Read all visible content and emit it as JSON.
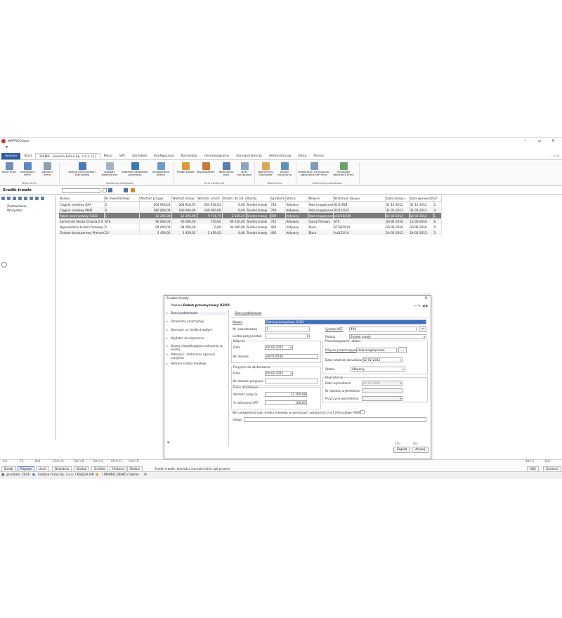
{
  "window": {
    "title": "WAPRO Kaper"
  },
  "tabs": [
    "System",
    "Start",
    "FIRMA : Solidna Firma Sp. z o.o. [1]",
    "Płace",
    "VAT",
    "Kartoteki",
    "Konfiguracja",
    "Narzędzia",
    "Harmonogramy",
    "Korespondencja",
    "Administracja",
    "Okna",
    "Pomoc"
  ],
  "ribbon": {
    "buttons": [
      {
        "label": "Dane firmy"
      },
      {
        "label": "Udziałowcy firmy"
      },
      {
        "label": "Zamknij firmę"
      },
      {
        "label": "Księga przychodów i rozchodów"
      },
      {
        "label": "Dowody wewnętrzne"
      },
      {
        "label": "Składniki zestawień sprzedaży"
      },
      {
        "label": "Księgowanie detalu"
      },
      {
        "label": "Środki trwałe"
      },
      {
        "label": "Wyposażenie"
      },
      {
        "label": "Rozliczenie jazd"
      },
      {
        "label": "Noty korygujące"
      },
      {
        "label": "Dokumenty finansowe"
      },
      {
        "label": "Zapisy rozliczenia"
      },
      {
        "label": "Deklaracje, Formularze, zgłoszenia NIP firmy"
      },
      {
        "label": "Szczegóły deklaracji firmy"
      }
    ],
    "groups": [
      "Dane firmy",
      "Ewidencja księgowa",
      "Inne ewidencje",
      "Rozliczenia",
      "Deklaracje podatkowe"
    ]
  },
  "section": {
    "title": "Środki trwałe"
  },
  "tree": [
    "Zaznaczone",
    "Wszystko"
  ],
  "grid": {
    "columns": [
      "Nazwa",
      "Nr inwentarzowy",
      "Wartość przyjęc",
      "Wartość bieżąc",
      "Wartość umorz",
      "Pozost. do zał. o",
      "Rodzaj",
      "Symbol K",
      "Status",
      "Miejsce",
      "Nr/data/w zakupu",
      "Data zakupu",
      "Data wprowadź",
      "LP"
    ],
    "rows": [
      [
        "Ciągnik siodłowy DAF",
        "2",
        "204 918,03",
        "204 918,03",
        "204 918,03",
        "0,00",
        "Środek trwały",
        "746",
        "Aktywny",
        "Hala magazynowa",
        "01/1/958",
        "31-12-2012",
        "31-12-2012",
        "2"
      ],
      [
        "Ciągnik siodłowy MAN",
        "4",
        "180 000,00",
        "180 000,00",
        "180 000,00",
        "0,00",
        "Środek trwały",
        "746",
        "Aktywny",
        "Hala magazynowa",
        "02/11/555",
        "31-01-2013",
        "31-01-2013",
        "4"
      ],
      [
        "Robot przemysłowy R2D2",
        "1",
        "12 295,08",
        "12 295,08",
        "9 774,79",
        "2 520,29",
        "Środek trwały",
        "490",
        "Aktywny",
        "Hala magazynowa",
        "e02/10/546",
        "02-02-2012",
        "02-02-2012",
        "1"
      ],
      [
        "Samochód Skoda Octavia 2.0",
        "ST6",
        "90 000,00",
        "90 000,00",
        "750,00",
        "89 250,00",
        "Środek trwały",
        "741",
        "Aktywny",
        "Garaż firmowy",
        "ST6",
        "30-04-2016",
        "12-06-2016",
        "6"
      ],
      [
        "Wyposażenie kuchni firmowej",
        "5",
        "94 000,00",
        "94 000,00",
        "0,00",
        "94 000,00",
        "Środek trwały",
        "493",
        "Aktywny",
        "Biuro",
        "ST18/2014",
        "30-06-2016",
        "30-06-2016",
        "5"
      ],
      [
        "Zestaw komputerowy Phenom",
        "13",
        "2 459,02",
        "2 459,02",
        "2 459,02",
        "0,00",
        "Środek trwały",
        "491",
        "Aktywny",
        "Biuro",
        "fvz321/14",
        "14-01-2013",
        "14-01-2013",
        "3"
      ]
    ]
  },
  "dialog": {
    "title": "Środek trwały",
    "name_label": "Nazwa",
    "name_value": "Robot przemysłowy R2D2",
    "nav": [
      "Dane podstawowe",
      "Parametry amortyzacji",
      "Operacje na środku trwałym",
      "Wydatki na ulepszenie",
      "Koszty niepodlegające zaliczeniu w koszty",
      "Płatności i rozliczenia operacji przyjęcia",
      "Historia środka trwałego"
    ],
    "form_tab": "Dane podstawowe",
    "nazwa_label": "Nazwa",
    "nazwa": "Robot przemysłowy R2D2",
    "nr_inw_label": "Nr inwentarzowy",
    "nr_inw": "1",
    "symbol_kst_label": "Symbol KŚT",
    "symbol_kst": "490",
    "liczba_label": "Liczba pozycji/sztuk",
    "liczba": "1",
    "rodzaj_label": "Rodzaj",
    "rodzaj": "Środek trwały",
    "nabycie_title": "Nabycie",
    "data_label": "Data",
    "nabycie_data": "02-02-2012",
    "nr_dowodu_label": "Nr dowodu",
    "nabycie_nr": "e02/10/546",
    "przech_title": "Przechowywanie, status",
    "miejsce_label": "Miejsce przechowywania",
    "miejsce": "Hala magazynowa",
    "data_akt_label": "Data ostatniej aktualizacji",
    "data_akt": "02-02-2012",
    "status_label": "Status",
    "status": "Aktywny",
    "przyjecie_title": "Przyjęcie do użytkowania",
    "przyjecie_data": "02-02-2012",
    "nr_dowodu_przyj_label": "Nr dowodu przyjęcia",
    "nr_dowodu_przyj": "",
    "wykreslenie_title": "Wykreślenie",
    "data_wykr_label": "Data wykreślenia",
    "data_wykr": "01-01-2000",
    "nr_dowodu_wykr_label": "Nr dowodu wykreślenia",
    "przyczyna_label": "Przyczyna wykreślenia",
    "dodatkowe_title": "Dane dodatkowe",
    "wartosc_nabycia_label": "Wartość nabycia",
    "wartosc_nabycia": "12 295,08",
    "odliczenia_label": "% odliczenia VAT",
    "odliczenia": "100,00",
    "checkbox_label": "Nie uwzględniaj tego środka trwałego w operacjach związanych z art 24d ustawy PDOF",
    "uwagi_label": "Uwagi",
    "uwagi": "",
    "fkeys": [
      "F10",
      "Esc"
    ],
    "save_label": "Zapisz",
    "cancel_label": "Anuluj"
  },
  "fkeys": [
    "Ins",
    "F2",
    "Del",
    "Ctrl+A",
    "Ctrl+D",
    "Ctrl+G",
    "Ctrl+H",
    "Ctrl+R",
    "Alt+1",
    "Esc"
  ],
  "bottom_buttons": [
    "Dodaj",
    "Popraw",
    "Usuń",
    "Działania",
    "Drukuj",
    "Grafika",
    "Historia",
    "Rodzic"
  ],
  "bottom_right_buttons": [
    "ABS",
    "Zamknij"
  ],
  "status_hint": "Środki trwałe, wartości niematerialne lub prawne",
  "statusbar": [
    "grudzień, 2016",
    "Solidna Firma Sp. z o.o. / KSIĘGA PiR",
    "/ WAPRO_DEMO / admin"
  ],
  "colors": {
    "accent": "#2b5b9a",
    "selected_row": "#7a7a7a",
    "highlight": "#3b6fc0"
  }
}
